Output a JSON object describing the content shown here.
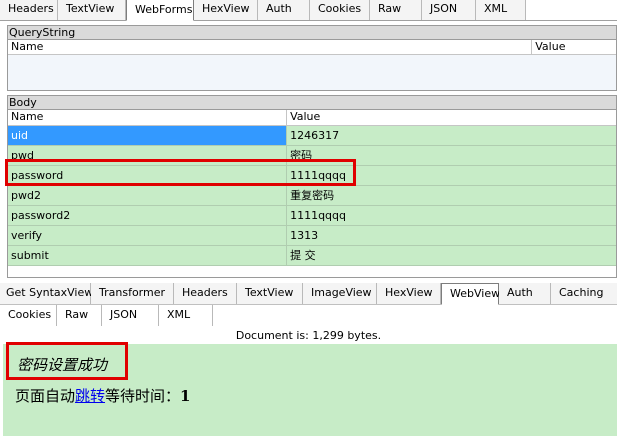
{
  "request_tabs": [
    "Headers",
    "TextView",
    "WebForms",
    "HexView",
    "Auth",
    "Cookies",
    "Raw",
    "JSON",
    "XML"
  ],
  "request_active_tab": "WebForms",
  "querystring": {
    "title": "QueryString",
    "col_name": "Name",
    "col_value": "Value"
  },
  "body": {
    "title": "Body",
    "col_name": "Name",
    "col_value": "Value",
    "rows": [
      {
        "name": "uid",
        "value": "1246317"
      },
      {
        "name": "pwd",
        "value": "密码"
      },
      {
        "name": "password",
        "value": "1111qqqq"
      },
      {
        "name": "pwd2",
        "value": "重复密码"
      },
      {
        "name": "password2",
        "value": "1111qqqq"
      },
      {
        "name": "verify",
        "value": "1313"
      },
      {
        "name": "submit",
        "value": "提 交"
      }
    ]
  },
  "response_tabs_row1": [
    "Get SyntaxView",
    "Transformer",
    "Headers",
    "TextView",
    "ImageView",
    "HexView",
    "WebView",
    "Auth",
    "Caching"
  ],
  "response_tabs_row2": [
    "Cookies",
    "Raw",
    "JSON",
    "XML"
  ],
  "response_active_tab": "WebView",
  "status_text": "Document is: 1,299 bytes.",
  "webview": {
    "title": "密码设置成功",
    "text_before": "页面自动",
    "link": "跳转",
    "text_after": "等待时间：",
    "countdown": "1"
  },
  "colors": {
    "row_bg": "#c7ecc7",
    "selected_bg": "#3399ff",
    "highlight": "#e00000"
  }
}
